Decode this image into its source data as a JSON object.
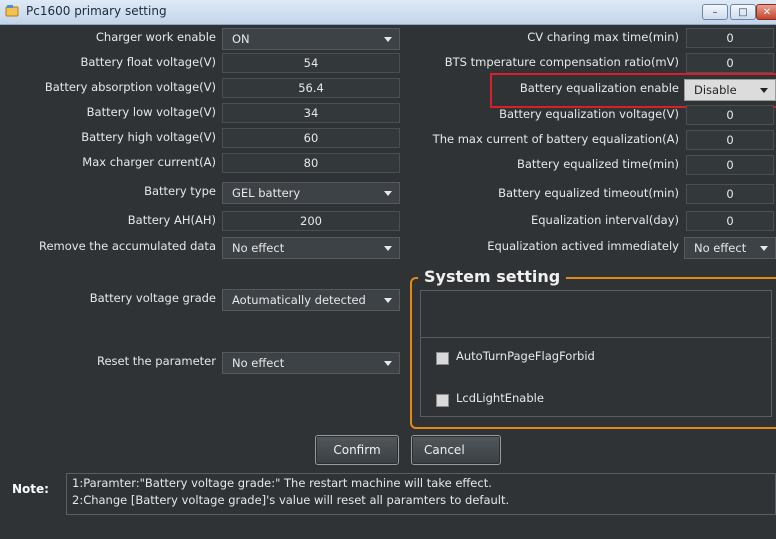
{
  "window": {
    "title": "Pc1600 primary setting"
  },
  "left": [
    {
      "label": "Charger work enable",
      "value": "ON",
      "kind": "select"
    },
    {
      "label": "Battery float voltage(V)",
      "value": "54",
      "kind": "value"
    },
    {
      "label": "Battery absorption voltage(V)",
      "value": "56.4",
      "kind": "value"
    },
    {
      "label": "Battery low voltage(V)",
      "value": "34",
      "kind": "value"
    },
    {
      "label": "Battery high voltage(V)",
      "value": "60",
      "kind": "value"
    },
    {
      "label": "Max charger current(A)",
      "value": "80",
      "kind": "value"
    },
    {
      "label": "Battery type",
      "value": "GEL battery",
      "kind": "select"
    },
    {
      "label": "Battery AH(AH)",
      "value": "200",
      "kind": "value"
    },
    {
      "label": "Remove the accumulated data",
      "value": "No effect",
      "kind": "select"
    },
    {
      "label": "Battery voltage grade",
      "value": "Aotumatically detected",
      "kind": "select"
    },
    {
      "label": "Reset the parameter",
      "value": "No effect",
      "kind": "select"
    }
  ],
  "right": [
    {
      "label": "CV charing max time(min)",
      "value": "0",
      "kind": "value"
    },
    {
      "label": "BTS tmperature compensation ratio(mV)",
      "value": "0",
      "kind": "value"
    },
    {
      "label": "Battery equalization enable",
      "value": "Disable",
      "kind": "select"
    },
    {
      "label": "Battery equalization voltage(V)",
      "value": "0",
      "kind": "value"
    },
    {
      "label": "The max current of battery equalization(A)",
      "value": "0",
      "kind": "value"
    },
    {
      "label": "Battery equalized time(min)",
      "value": "0",
      "kind": "value"
    },
    {
      "label": "Battery equalized timeout(min)",
      "value": "0",
      "kind": "value"
    },
    {
      "label": "Equalization interval(day)",
      "value": "0",
      "kind": "value"
    },
    {
      "label": "Equalization actived immediately",
      "value": "No effect",
      "kind": "select"
    }
  ],
  "system": {
    "title": "System setting",
    "options": [
      {
        "label": "AutoTurnPageFlagForbid",
        "checked": false
      },
      {
        "label": "LcdLightEnable",
        "checked": false
      }
    ]
  },
  "buttons": {
    "confirm": "Confirm",
    "cancel": "Cancel"
  },
  "note": {
    "label": "Note:",
    "lines": [
      "1:Paramter:\"Battery voltage grade:\" The restart machine will take effect.",
      "2:Change [Battery voltage grade]'s value will reset all paramters to default."
    ]
  },
  "colors": {
    "background": "#2f3336",
    "highlight": "#d8202a",
    "group_border": "#e38a14"
  }
}
